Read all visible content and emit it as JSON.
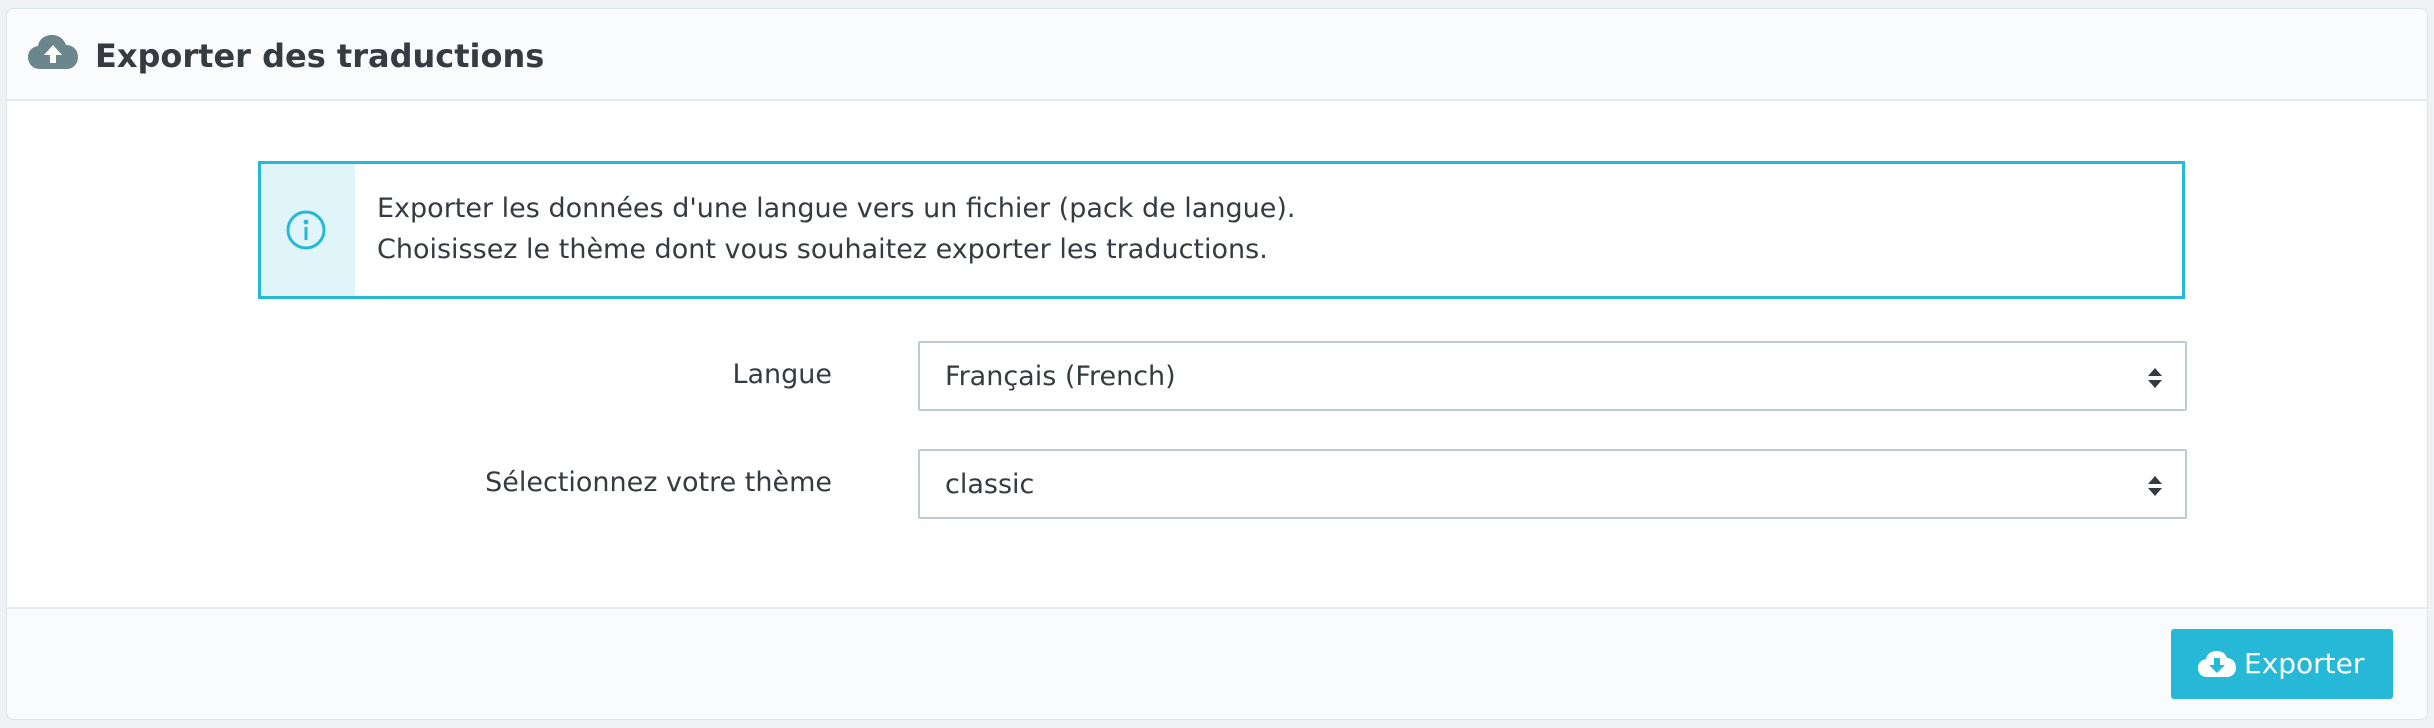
{
  "header": {
    "icon": "cloud-upload-icon",
    "title": "Exporter des traductions"
  },
  "alert": {
    "icon": "info-icon",
    "line1": "Exporter les données d'une langue vers un fichier (pack de langue).",
    "line2": "Choisissez le thème dont vous souhaitez exporter les traductions."
  },
  "form": {
    "language": {
      "label": "Langue",
      "selected": "Français (French)"
    },
    "theme": {
      "label": "Sélectionnez votre thème",
      "selected": "classic"
    }
  },
  "footer": {
    "export_icon": "cloud-download-icon",
    "export_label": "Exporter"
  },
  "colors": {
    "accent": "#25b9d7",
    "alert_bg": "#dff5f9",
    "header_icon": "#6c868e",
    "text": "#363a41"
  }
}
